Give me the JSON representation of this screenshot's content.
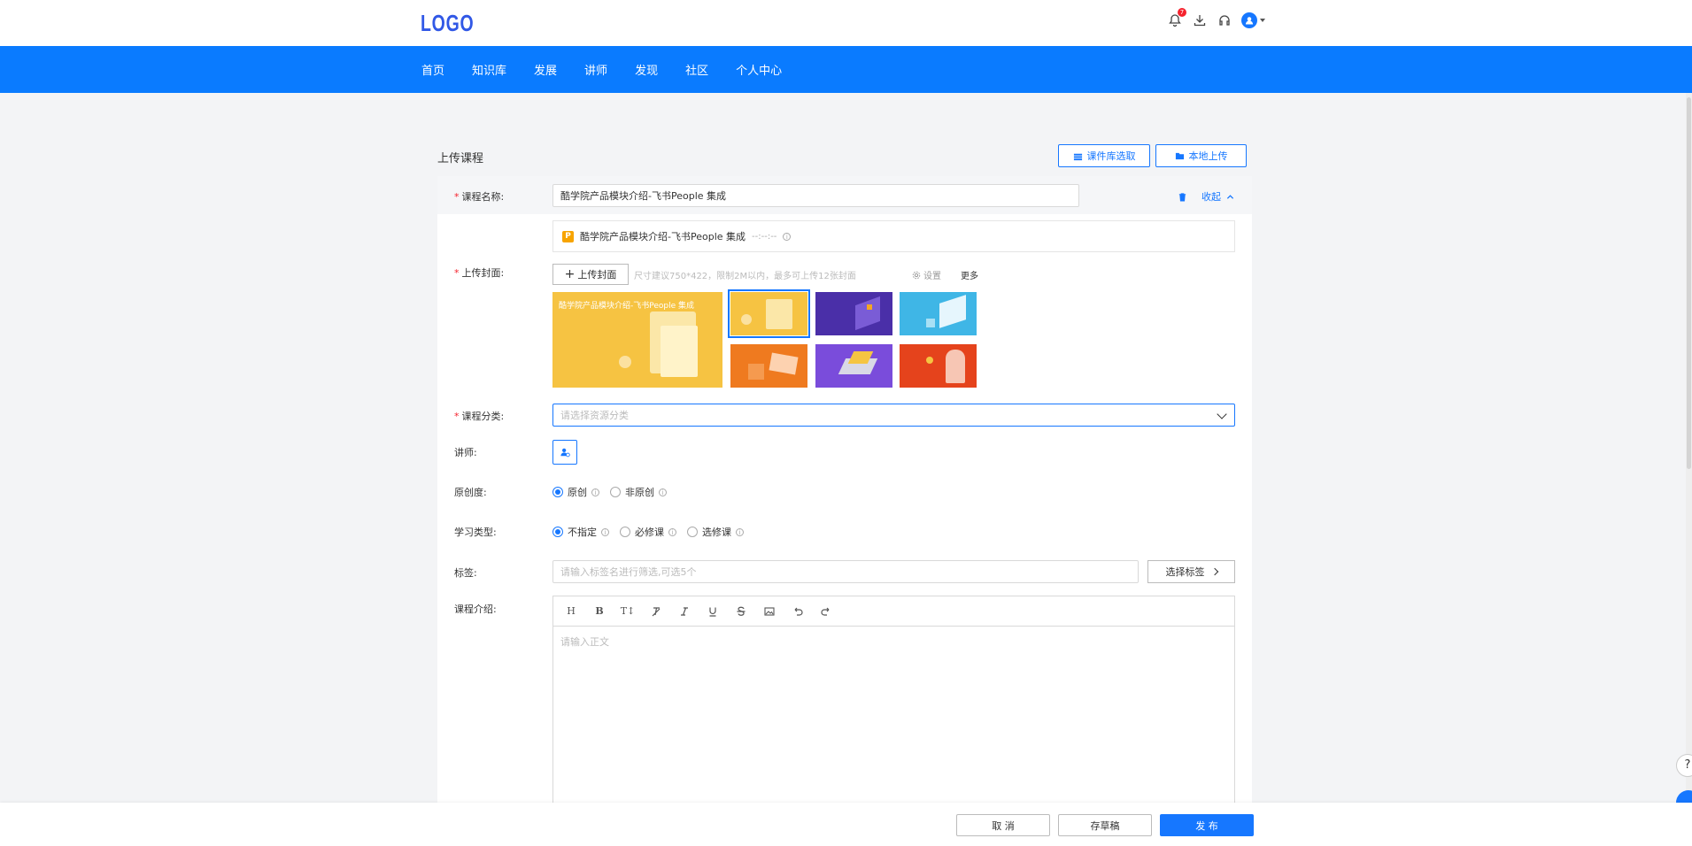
{
  "header": {
    "logo": "LOGO",
    "notification_count": "7"
  },
  "nav": {
    "items": [
      "首页",
      "知识库",
      "发展",
      "讲师",
      "发现",
      "社区",
      "个人中心"
    ]
  },
  "page": {
    "title": "上传课程",
    "library_btn": "课件库选取",
    "local_upload_btn": "本地上传"
  },
  "form": {
    "name_label": "课程名称:",
    "name_value": "酷学院产品模块介绍-飞书People 集成",
    "collapse": "收起",
    "file": {
      "type_badge": "P",
      "name": "酷学院产品模块介绍-飞书People 集成",
      "meta": "--:--:--"
    },
    "cover_label": "上传封面:",
    "upload_cover_btn": "上传封面",
    "cover_hint": "尺寸建议750*422，限制2M以内，最多可上传12张封面",
    "settings": "设置",
    "more": "更多",
    "cover_title": "酷学院产品模块介绍-飞书People 集成",
    "category_label": "课程分类:",
    "category_placeholder": "请选择资源分类",
    "teacher_label": "讲师:",
    "originality_label": "原创度:",
    "originality_options": [
      "原创",
      "非原创"
    ],
    "study_type_label": "学习类型:",
    "study_type_options": [
      "不指定",
      "必修课",
      "选修课"
    ],
    "tags_label": "标签:",
    "tags_placeholder": "请输入标签名进行筛选,可选5个",
    "choose_tags_btn": "选择标签",
    "intro_label": "课程介绍:",
    "editor_placeholder": "请输入正文",
    "editor_tools": [
      "H",
      "B",
      "T↕"
    ]
  },
  "footer": {
    "cancel": "取 消",
    "draft": "存草稿",
    "publish": "发 布"
  },
  "colors": {
    "primary": "#1677ff",
    "nav_bg": "#0a7bff",
    "required": "#f5222d"
  }
}
